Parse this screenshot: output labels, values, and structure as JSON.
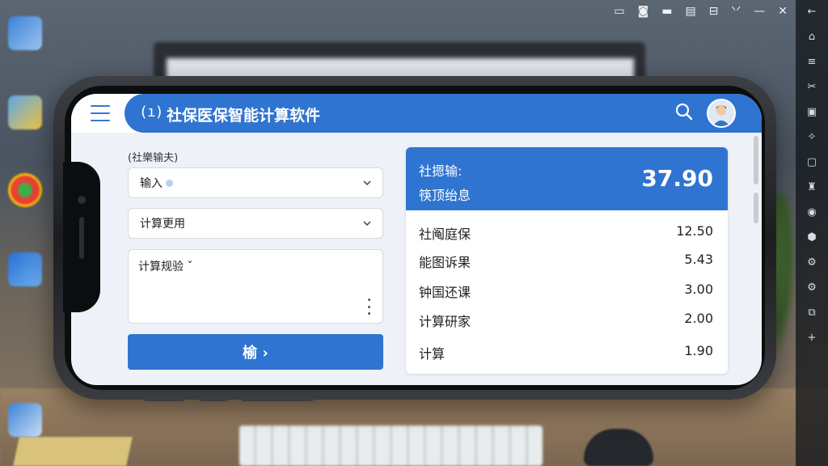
{
  "app": {
    "title": "社保医保智能计算软件",
    "menu_icon": "hamburger-menu-icon",
    "signal_icon": "(ı)",
    "accent_color": "#2f74d0"
  },
  "form": {
    "caption": "(社樂输夫)",
    "field_input": {
      "label": "输入"
    },
    "field_select": {
      "label": "计算更用"
    },
    "field_textarea": {
      "label": "计算规验 ˇ"
    },
    "submit_label": "榆 ›"
  },
  "results": {
    "header_line1": "社摁输:",
    "header_line2": "筷顶绐息",
    "total": "37.90",
    "rows": [
      {
        "label": "社阄庭保",
        "value": "12.50"
      },
      {
        "label": "能图诉果",
        "value": "5.43"
      },
      {
        "label": "钟国还课",
        "value": "3.00"
      },
      {
        "label": "计算研家",
        "value": "2.00"
      },
      {
        "label": "计算",
        "value": "1.90"
      }
    ]
  },
  "desktop": {
    "topbar_icons": [
      "▭",
      "◙",
      "▬",
      "▤",
      "⊟",
      "ᐠᐟ",
      "—",
      "✕"
    ],
    "rail_icons": [
      "←",
      "⌂",
      "≡",
      "✂",
      "▣",
      "✧",
      "▢",
      "♜",
      "◉",
      "⬢",
      "⚙",
      "⚙",
      "⧉",
      "+"
    ]
  }
}
